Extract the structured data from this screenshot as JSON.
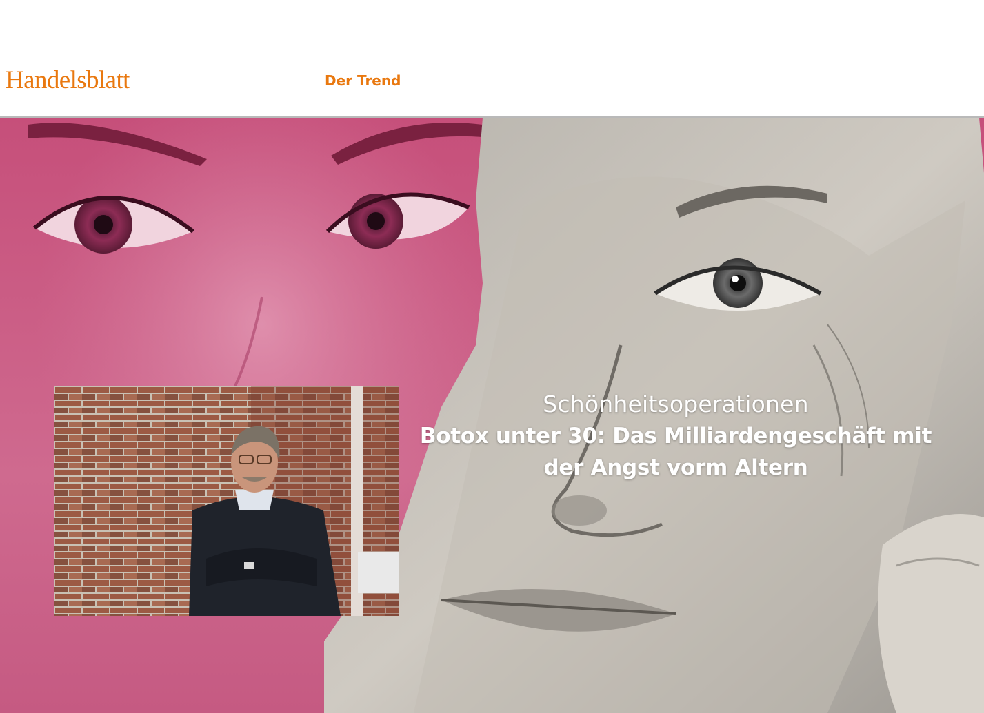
{
  "header": {
    "logo": "Handelsblatt",
    "section_link": "Der Trend"
  },
  "article": {
    "kicker": "Schönheitsoperationen",
    "title_line1": "Botox unter 30: Das Milliardengeschäft mit",
    "title_line2": "der Angst vorm Altern"
  },
  "colors": {
    "brand": "#e9780f",
    "hero_pink": "#c9557f",
    "headline_text": "#ffffff"
  },
  "images": {
    "hero": "collage-pink-face-and-older-face",
    "author": "man-in-dark-sweater-leaning-on-brick-wall"
  }
}
